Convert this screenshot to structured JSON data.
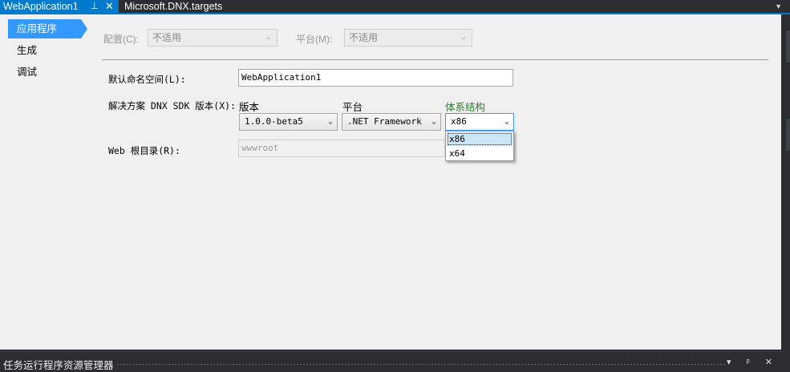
{
  "tabs": {
    "active": {
      "label": "WebApplication1",
      "pin": "ᵖ",
      "close": "✕"
    },
    "second": {
      "label": "Microsoft.DNX.targets"
    },
    "dropdown_glyph": "▼"
  },
  "sidebar": {
    "items": [
      {
        "label": "应用程序",
        "selected": true
      },
      {
        "label": "生成"
      },
      {
        "label": "调试"
      }
    ]
  },
  "config": {
    "config_label": "配置(C):",
    "config_value": "不适用",
    "platform_label": "平台(M):",
    "platform_value": "不适用"
  },
  "form": {
    "namespace_label": "默认命名空间(L):",
    "namespace_value": "WebApplication1",
    "sdk_label": "解决方案 DNX SDK 版本(X):",
    "col_version": "版本",
    "col_platform": "平台",
    "col_arch": "体系结构",
    "version_value": "1.0.0-beta5",
    "platform_value": ".NET Framework",
    "arch_value": "x86",
    "arch_options": [
      "x86",
      "x64"
    ],
    "webroot_label": "Web 根目录(R):",
    "webroot_value": "wwwroot"
  },
  "bottom_panel": {
    "title": "任务运行程序资源管理器",
    "buttons": "▾ ᵖ ✕"
  },
  "colors": {
    "accent": "#007acc",
    "selected_nav": "#3399ff",
    "arch_header": "#2e7d32"
  }
}
